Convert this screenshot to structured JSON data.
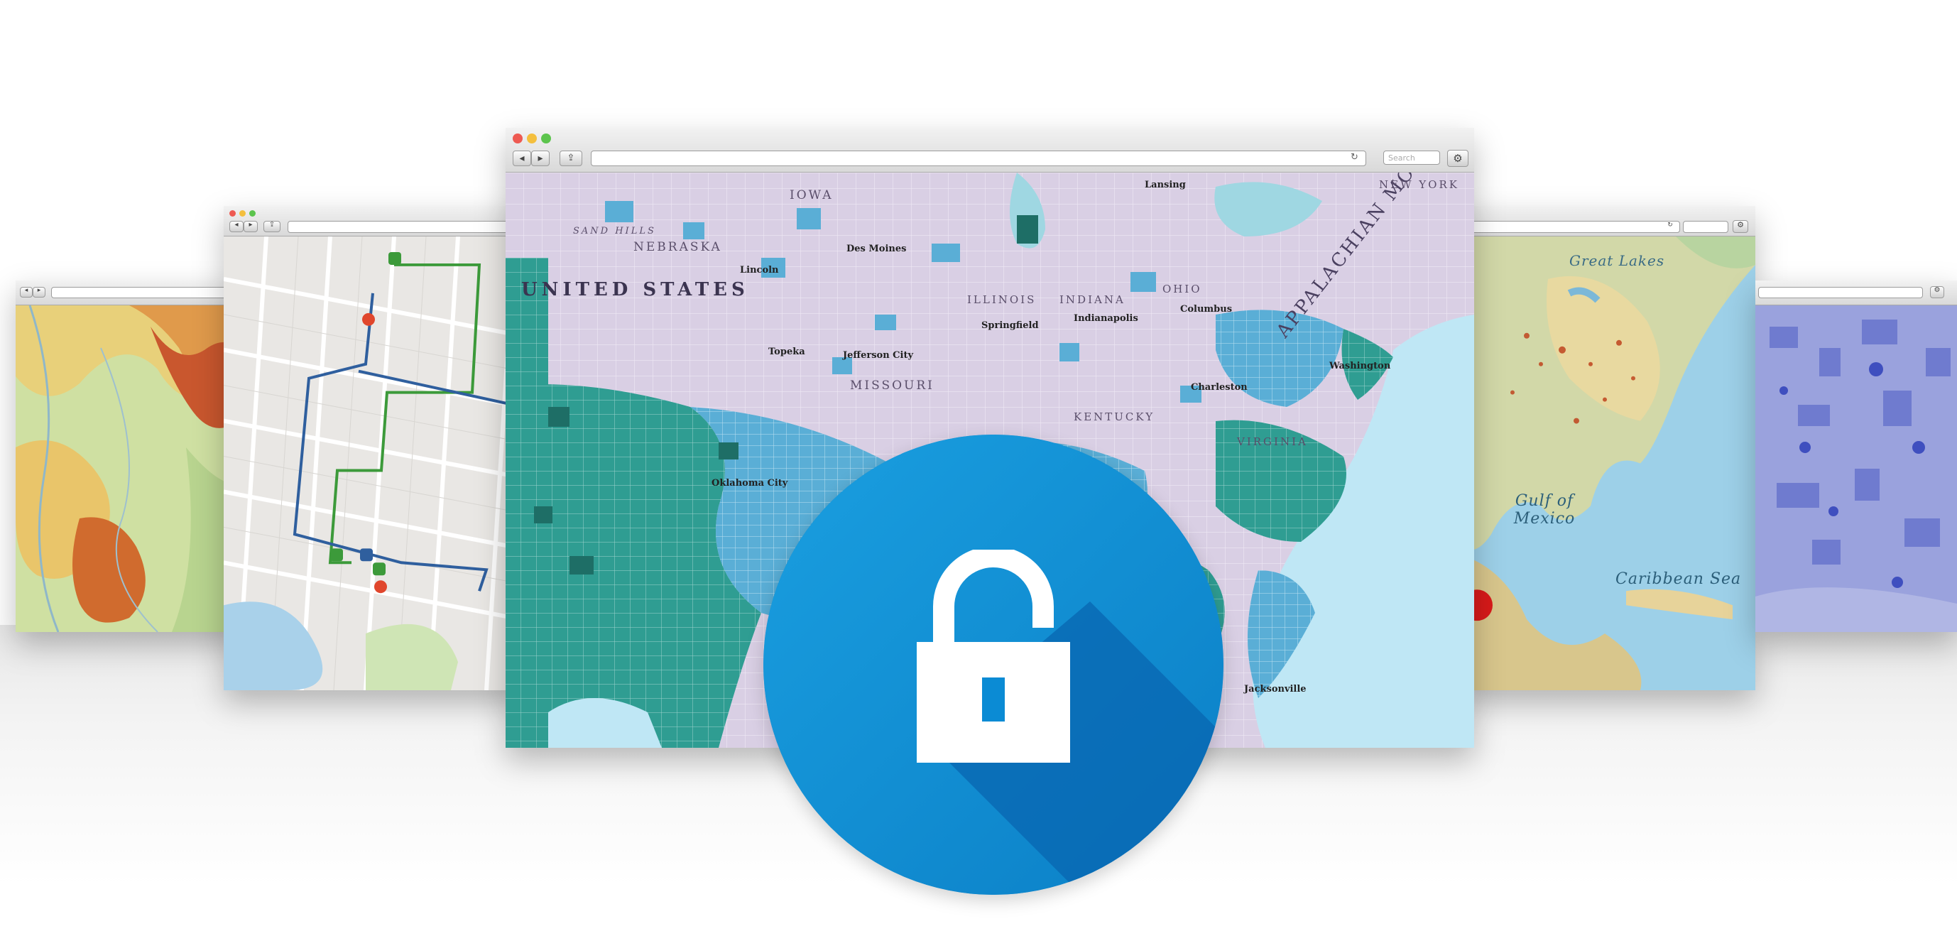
{
  "scene": {
    "accent_color": "#0b8bd4",
    "icon": "lock-icon"
  },
  "main_window": {
    "url": "",
    "search_placeholder": "Search",
    "map_labels": {
      "country": "UNITED STATES",
      "mountains": "APPALACHIAN MOUNTAINS",
      "nebraska": "NEBRASKA",
      "sand_hills": "SAND HILLS",
      "missouri": "MISSOURI",
      "kentucky": "KENTUCKY",
      "virginia": "VIRGINIA",
      "indiana": "INDIANA",
      "illinois": "ILLINOIS",
      "ohio": "OHIO",
      "iowa": "IOWA",
      "des_moines": "Des Moines",
      "lincoln": "Lincoln",
      "springfield": "Springfield",
      "indianapolis": "Indianapolis",
      "columbus": "Columbus",
      "charleston": "Charleston",
      "washington": "Washington",
      "jefferson_city": "Jefferson City",
      "topeka": "Topeka",
      "oklahoma_city": "Oklahoma City",
      "lansing": "Lansing",
      "jacksonville": "Jacksonville",
      "new_york": "NEW YORK"
    }
  },
  "right_window": {
    "map_labels": {
      "great_lakes": "Great Lakes",
      "gulf": "Gulf of Mexico",
      "caribbean": "Caribbean Sea"
    }
  }
}
